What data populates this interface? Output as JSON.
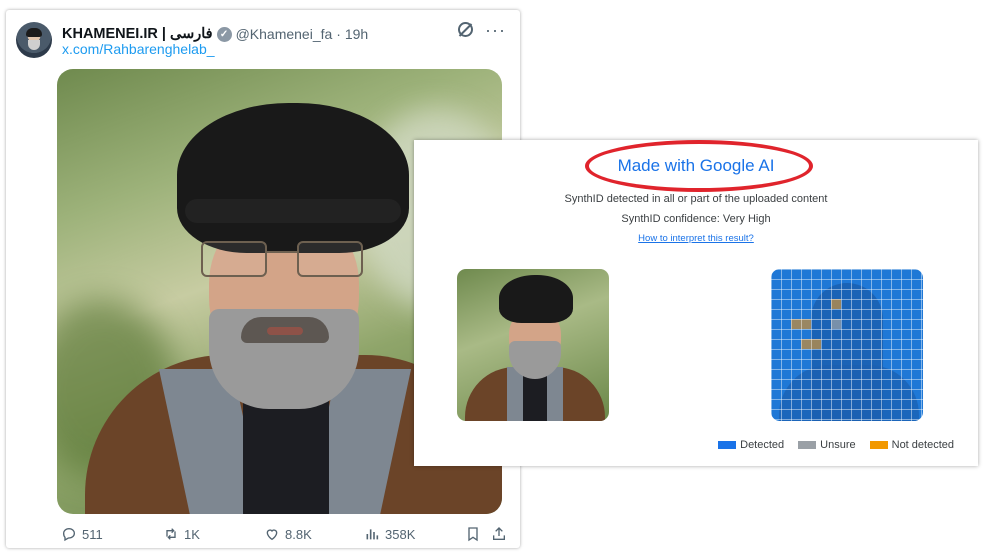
{
  "tweet": {
    "display_name": "KHAMENEI.IR | فارسی",
    "handle": "@Khamenei_fa",
    "time": "· 19h",
    "link": "x.com/Rahbarenghelab_",
    "icons": {
      "verified": "verified-badge-icon",
      "grok": "grok-icon",
      "more": "more-icon"
    },
    "actions": {
      "replies": "511",
      "retweets": "1K",
      "likes": "8.8K",
      "views": "358K"
    }
  },
  "synthid": {
    "title": "Made with Google AI",
    "detected_text": "SynthID detected in all or part of the uploaded content",
    "confidence_text": "SynthID confidence: Very High",
    "help_link": "How to interpret this result?",
    "legend": [
      {
        "label": "Detected",
        "color": "#1a73e8"
      },
      {
        "label": "Unsure",
        "color": "#9aa0a6"
      },
      {
        "label": "Not detected",
        "color": "#f29900"
      }
    ]
  },
  "colors": {
    "accent": "#1d9bf0",
    "highlight_ring": "#e0242c",
    "link": "#1a73e8"
  }
}
